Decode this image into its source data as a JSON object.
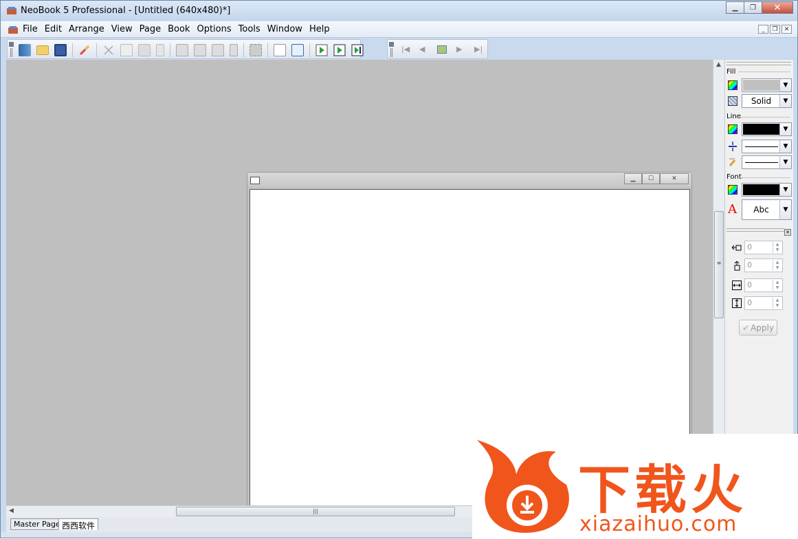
{
  "app": {
    "title": "NeoBook 5 Professional - [Untitled (640x480)*]",
    "icon": "neobook-app-icon"
  },
  "caption_buttons": {
    "minimize": "▁",
    "restore": "❐",
    "close": "✕"
  },
  "menubar": {
    "items": [
      "File",
      "Edit",
      "Arrange",
      "View",
      "Page",
      "Book",
      "Options",
      "Tools",
      "Window",
      "Help"
    ]
  },
  "toolbar_main": {
    "icons": [
      "new-book-icon",
      "open-folder-icon",
      "save-icon",
      "eraser-icon",
      "cut-icon",
      "copy-icon",
      "paste-icon",
      "delete-icon",
      "bring-front-icon",
      "send-back-icon",
      "group-icon",
      "ungroup-icon",
      "select-all-icon",
      "new-page-icon",
      "properties-icon",
      "run-icon",
      "run-page-icon",
      "preview-icon"
    ]
  },
  "toolbar_nav": {
    "icons": [
      "first-page-icon",
      "prev-page-icon",
      "page-icon",
      "next-page-icon",
      "last-page-icon"
    ]
  },
  "document": {
    "icon": "document-icon"
  },
  "tabs": [
    "Master Page",
    "西西软件"
  ],
  "panel": {
    "fill_label": "Fill",
    "fill_style": "Solid",
    "line_label": "Line",
    "font_label": "Font",
    "font_sample": "Abc",
    "colors": {
      "fill": "#c0c0c0",
      "line": "#000000",
      "font": "#000000"
    },
    "position_values": [
      "0",
      "0",
      "0",
      "0"
    ],
    "apply_label": "Apply"
  },
  "watermark": {
    "chinese": "下载火",
    "domain": "xiazaihuo.com",
    "color": "#f0551c"
  }
}
